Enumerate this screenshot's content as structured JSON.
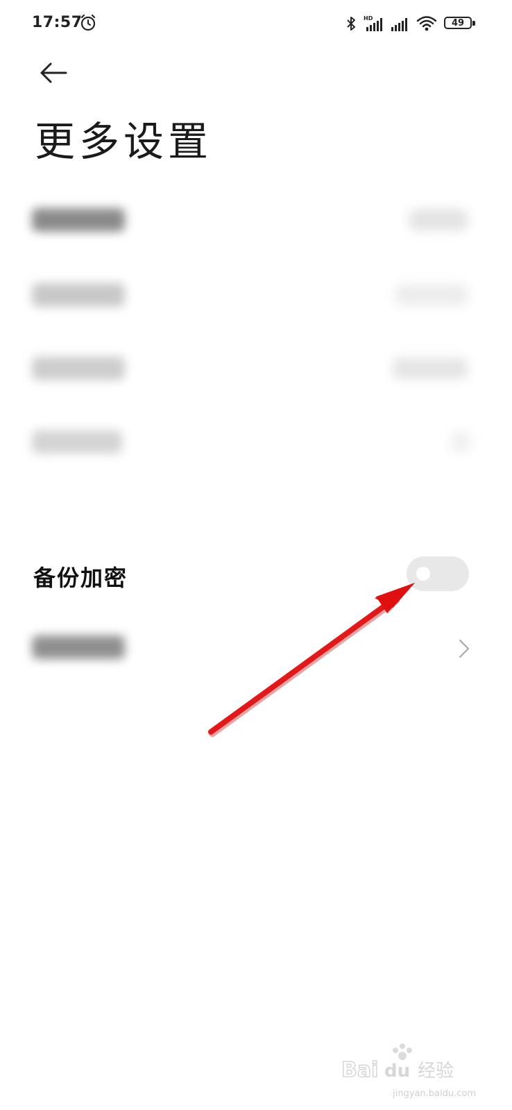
{
  "status_bar": {
    "time": "17:57",
    "battery": "49",
    "icons": [
      "alarm-icon",
      "bluetooth-icon",
      "hd-signal-icon",
      "signal-icon",
      "wifi-icon",
      "battery-icon"
    ]
  },
  "header": {
    "back_icon": "back-arrow-icon",
    "title": "更多设置"
  },
  "blurred_items_count_note": "",
  "backup_encryption": {
    "label": "备份加密",
    "toggle_on": false
  },
  "watermark": {
    "brand": "Baidu经验",
    "sub": "jingyan.baidu.com"
  },
  "colors": {
    "toggle_off": "#e8e8e8",
    "annotation_arrow": "#e01010"
  }
}
